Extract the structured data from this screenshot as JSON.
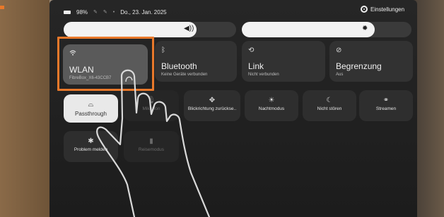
{
  "status": {
    "battery": "98%",
    "date": "Do., 23. Jan. 2025",
    "settings_label": "Einstellungen"
  },
  "sliders": {
    "volume_icon": "speaker-icon",
    "brightness_icon": "sun-icon"
  },
  "tiles": [
    {
      "title": "WLAN",
      "subtitle": "FibreBox_X6-43CCB7",
      "icon": "wifi-icon"
    },
    {
      "title": "Bluetooth",
      "subtitle": "Keine Geräte verbunden",
      "icon": "bluetooth-icon"
    },
    {
      "title": "Link",
      "subtitle": "Nicht verbunden",
      "icon": "link-icon"
    },
    {
      "title": "Begrenzung",
      "subtitle": "Aus",
      "icon": "boundary-icon"
    }
  ],
  "buttons": [
    {
      "label": "Passthrough",
      "icon": "passthrough-icon"
    },
    {
      "label": "Mikrofon",
      "icon": "microphone-icon"
    },
    {
      "label": "Blickrichtung zurückse..",
      "icon": "recenter-icon"
    },
    {
      "label": "Nachtmodus",
      "icon": "night-mode-icon"
    },
    {
      "label": "Nicht stören",
      "icon": "moon-icon"
    },
    {
      "label": "Streamen",
      "icon": "cast-icon"
    },
    {
      "label": "Problem melden",
      "icon": "bug-icon"
    },
    {
      "label": "Reisemodus",
      "icon": "travel-icon"
    }
  ]
}
